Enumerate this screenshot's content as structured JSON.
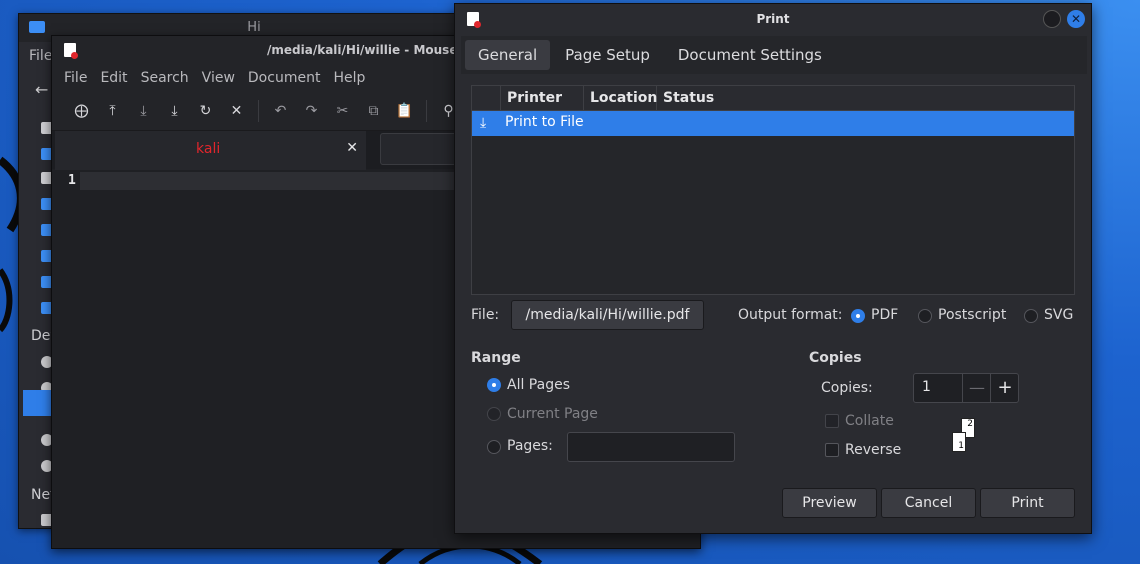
{
  "file_manager": {
    "title": "Hi",
    "menu_file": "File",
    "side_labels": [
      "Dev",
      "Net"
    ]
  },
  "mousepad": {
    "title": "/media/kali/Hi/willie - Mousepad",
    "menu": [
      "File",
      "Edit",
      "Search",
      "View",
      "Document",
      "Help"
    ],
    "tab_label": "kali",
    "line_number": "1"
  },
  "print_dialog": {
    "title": "Print",
    "tabs": [
      "General",
      "Page Setup",
      "Document Settings"
    ],
    "columns": [
      "Printer",
      "Location",
      "Status"
    ],
    "printer_row": "Print to File",
    "file_label": "File:",
    "file_path": "/media/kali/Hi/willie.pdf",
    "output_format_label": "Output format:",
    "formats": [
      "PDF",
      "Postscript",
      "SVG"
    ],
    "range_heading": "Range",
    "range_options": [
      "All Pages",
      "Current Page",
      "Pages:"
    ],
    "copies_heading": "Copies",
    "copies_label": "Copies:",
    "copies_value": "1",
    "collate_label": "Collate",
    "reverse_label": "Reverse",
    "page_icon_numbers": [
      "1",
      "2"
    ],
    "buttons": {
      "preview": "Preview",
      "cancel": "Cancel",
      "print": "Print"
    },
    "accent_color": "#2f7ee8"
  }
}
